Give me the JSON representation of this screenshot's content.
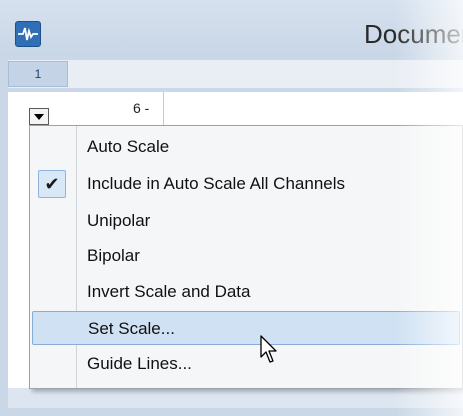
{
  "window": {
    "title": "Documen"
  },
  "tabs": [
    {
      "label": "1"
    }
  ],
  "axis": {
    "tick_label": "6 -"
  },
  "menu": {
    "items": [
      {
        "label": "Auto Scale",
        "checked": false,
        "highlighted": false
      },
      {
        "label": "Include in Auto Scale All Channels",
        "checked": true,
        "highlighted": false
      },
      {
        "label": "Unipolar",
        "checked": false,
        "highlighted": false
      },
      {
        "label": "Bipolar",
        "checked": false,
        "highlighted": false
      },
      {
        "label": "Invert Scale and Data",
        "checked": false,
        "highlighted": false
      },
      {
        "label": "Set Scale...",
        "checked": false,
        "highlighted": true
      },
      {
        "label": "Guide Lines...",
        "checked": false,
        "highlighted": false
      }
    ],
    "check_glyph": "✔"
  },
  "icons": {
    "app": "waveform-app-icon",
    "dropdown": "dropdown-arrow-icon",
    "check": "checkmark-icon",
    "cursor": "mouse-pointer-icon"
  },
  "colors": {
    "highlight": "#cfe1f3",
    "highlight_border": "#86add6",
    "app_icon": "#2f6fb5"
  }
}
